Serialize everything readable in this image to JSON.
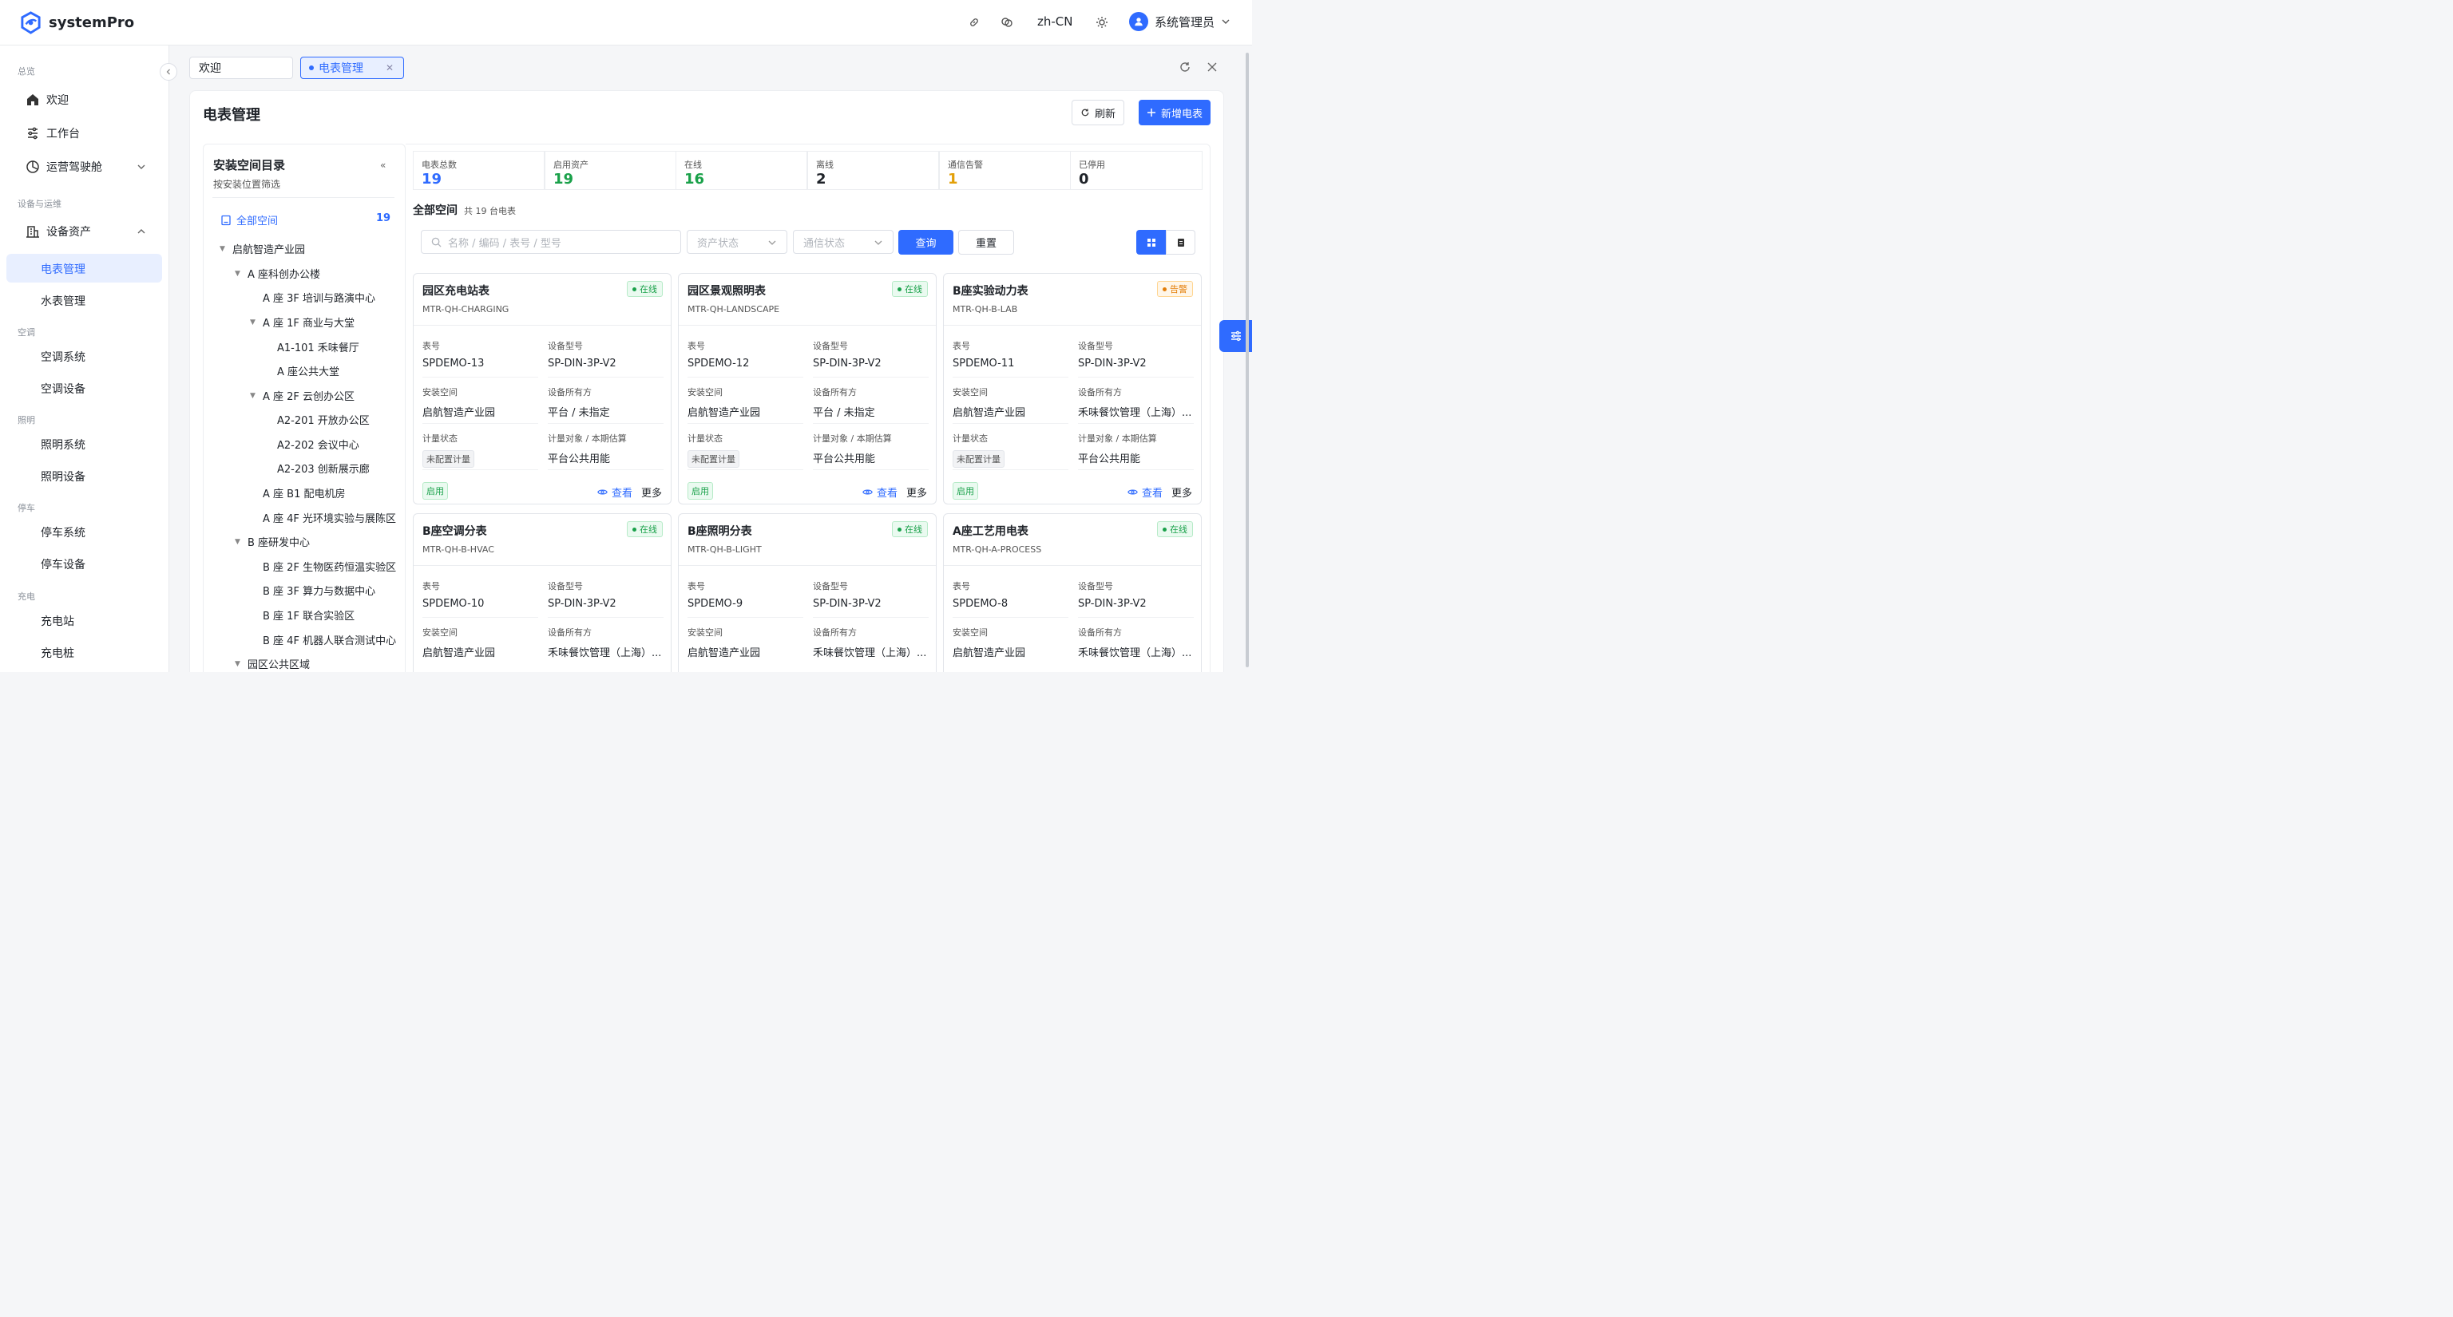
{
  "app": {
    "name": "systemPro"
  },
  "header": {
    "lang": "zh-CN",
    "user": "系统管理员"
  },
  "sidebar": {
    "groups": {
      "overview": "总览",
      "device_ops": "设备与运维",
      "hvac": "空调",
      "lighting": "照明",
      "parking": "停车",
      "charging": "充电"
    },
    "items": {
      "welcome": "欢迎",
      "workbench": "工作台",
      "cockpit": "运营驾驶舱",
      "assets": "设备资产",
      "meter": "电表管理",
      "water": "水表管理",
      "hvac_sys": "空调系统",
      "hvac_dev": "空调设备",
      "light_sys": "照明系统",
      "light_dev": "照明设备",
      "park_sys": "停车系统",
      "park_dev": "停车设备",
      "charge_station": "充电站",
      "charge_pile": "充电桩"
    }
  },
  "tabs": [
    {
      "label": "欢迎"
    },
    {
      "label": "电表管理"
    }
  ],
  "page": {
    "title": "电表管理",
    "refresh": "刷新",
    "add": "新增电表"
  },
  "tree": {
    "title": "安装空间目录",
    "subtitle": "按安装位置筛选",
    "collapse": "«",
    "all_label": "全部空间",
    "all_count": "19",
    "nodes": [
      {
        "label": "启航智造产业园"
      },
      {
        "label": "A 座科创办公楼"
      },
      {
        "label": "A 座 3F 培训与路演中心"
      },
      {
        "label": "A 座 1F 商业与大堂"
      },
      {
        "label": "A1-101 禾味餐厅"
      },
      {
        "label": "A 座公共大堂"
      },
      {
        "label": "A 座 2F 云创办公区"
      },
      {
        "label": "A2-201 开放办公区"
      },
      {
        "label": "A2-202 会议中心"
      },
      {
        "label": "A2-203 创新展示廊"
      },
      {
        "label": "A 座 B1 配电机房"
      },
      {
        "label": "A 座 4F 光环境实验与展陈区"
      },
      {
        "label": "B 座研发中心"
      },
      {
        "label": "B 座 2F 生物医药恒温实验区"
      },
      {
        "label": "B 座 3F 算力与数据中心"
      },
      {
        "label": "B 座 1F 联合实验区"
      },
      {
        "label": "B 座 4F 机器人联合测试中心"
      },
      {
        "label": "园区公共区域"
      }
    ]
  },
  "stats": [
    {
      "label": "电表总数",
      "value": "19",
      "color": "#2f6bff"
    },
    {
      "label": "启用资产",
      "value": "19",
      "color": "#1aa14a"
    },
    {
      "label": "在线",
      "value": "16",
      "color": "#1aa14a"
    },
    {
      "label": "离线",
      "value": "2",
      "color": "#1f2329"
    },
    {
      "label": "通信告警",
      "value": "1",
      "color": "#e3a008"
    },
    {
      "label": "已停用",
      "value": "0",
      "color": "#1f2329"
    }
  ],
  "space": {
    "title": "全部空间",
    "count": "共 19 台电表"
  },
  "filters": {
    "search_placeholder": "名称 / 编码 / 表号 / 型号",
    "asset_status": "资产状态",
    "comm_status": "通信状态",
    "query": "查询",
    "reset": "重置"
  },
  "card_labels": {
    "meter_no": "表号",
    "model": "设备型号",
    "space": "安装空间",
    "owner": "设备所有方",
    "metering": "计量状态",
    "target": "计量对象 / 本期估算",
    "enabled": "启用",
    "view": "查看",
    "more": "更多"
  },
  "meters": [
    {
      "name": "园区充电站表",
      "code": "MTR-QH-CHARGING",
      "status": "在线",
      "status_type": "online",
      "meter_no": "SPDEMO-13",
      "model": "SP-DIN-3P-V2",
      "space": "启航智造产业园",
      "owner": "平台 / 未指定",
      "metering": "未配置计量",
      "target": "平台公共用能"
    },
    {
      "name": "园区景观照明表",
      "code": "MTR-QH-LANDSCAPE",
      "status": "在线",
      "status_type": "online",
      "meter_no": "SPDEMO-12",
      "model": "SP-DIN-3P-V2",
      "space": "启航智造产业园",
      "owner": "平台 / 未指定",
      "metering": "未配置计量",
      "target": "平台公共用能"
    },
    {
      "name": "B座实验动力表",
      "code": "MTR-QH-B-LAB",
      "status": "告警",
      "status_type": "alert",
      "meter_no": "SPDEMO-11",
      "model": "SP-DIN-3P-V2",
      "space": "启航智造产业园",
      "owner": "禾味餐饮管理（上海）...",
      "metering": "未配置计量",
      "target": "平台公共用能"
    },
    {
      "name": "B座空调分表",
      "code": "MTR-QH-B-HVAC",
      "status": "在线",
      "status_type": "online",
      "meter_no": "SPDEMO-10",
      "model": "SP-DIN-3P-V2",
      "space": "启航智造产业园",
      "owner": "禾味餐饮管理（上海）..."
    },
    {
      "name": "B座照明分表",
      "code": "MTR-QH-B-LIGHT",
      "status": "在线",
      "status_type": "online",
      "meter_no": "SPDEMO-9",
      "model": "SP-DIN-3P-V2",
      "space": "启航智造产业园",
      "owner": "禾味餐饮管理（上海）..."
    },
    {
      "name": "A座工艺用电表",
      "code": "MTR-QH-A-PROCESS",
      "status": "在线",
      "status_type": "online",
      "meter_no": "SPDEMO-8",
      "model": "SP-DIN-3P-V2",
      "space": "启航智造产业园",
      "owner": "禾味餐饮管理（上海）..."
    }
  ]
}
